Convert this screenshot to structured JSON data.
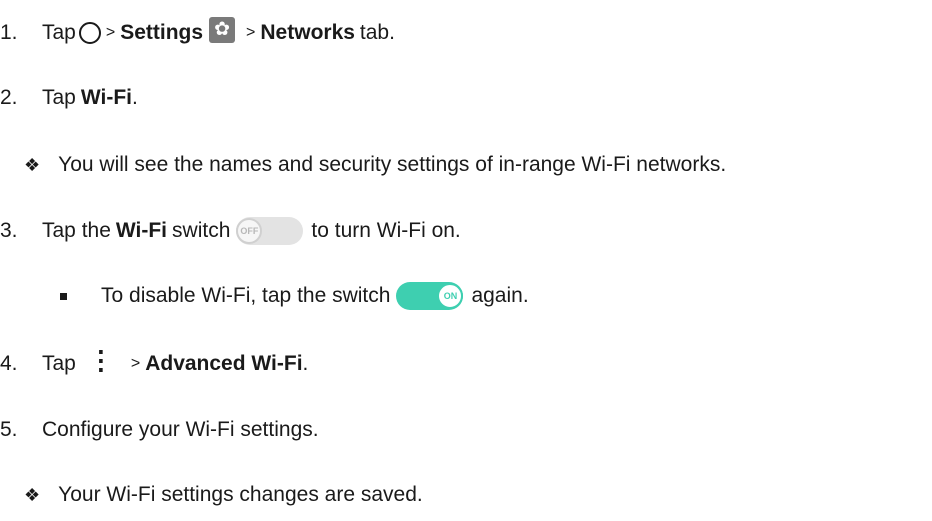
{
  "steps": [
    {
      "number": "1.",
      "tap": "Tap",
      "sep1": ">",
      "settings": "Settings",
      "sep2": ">",
      "networks": "Networks",
      "tab": "tab."
    },
    {
      "number": "2.",
      "tap": "Tap",
      "wifi": "Wi-Fi",
      "period": "."
    },
    {
      "number": "3.",
      "tap_the": "Tap the",
      "wifi": "Wi-Fi",
      "switch": "switch",
      "rest": "to turn Wi-Fi on."
    },
    {
      "number": "4.",
      "tap": "Tap",
      "sep": ">",
      "advanced": "Advanced Wi-Fi",
      "period": "."
    },
    {
      "number": "5.",
      "text": "Configure your Wi-Fi settings."
    }
  ],
  "notes": {
    "step2_result": "You will see the names and security settings of in-range Wi-Fi networks.",
    "step3_bullet_pre": "To disable Wi-Fi, tap the switch",
    "step3_bullet_post": "again.",
    "step5_result": "Your Wi-Fi settings changes are saved."
  },
  "switches": {
    "off_label": "OFF",
    "on_label": "ON"
  },
  "glyphs": {
    "gear": "✿",
    "menu": "⋮",
    "diamond": "❖"
  },
  "colors": {
    "switch_on": "#3ecfb0",
    "switch_off": "#e3e3e3",
    "gear_bg": "#7a7a7a"
  }
}
